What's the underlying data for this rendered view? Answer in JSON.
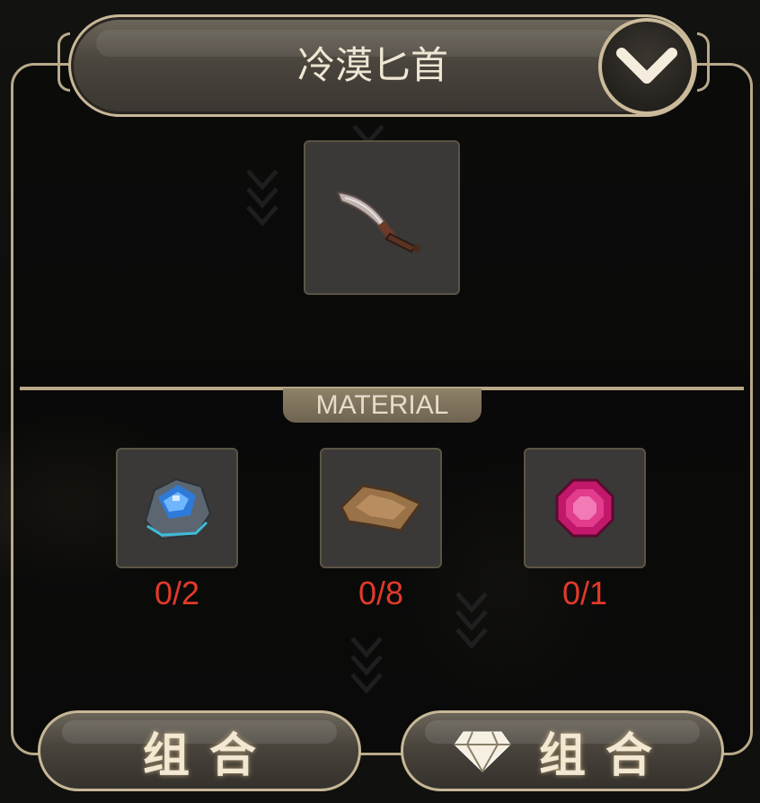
{
  "title": {
    "item_name": "冷漠匕首"
  },
  "crafting": {
    "result_item": {
      "icon": "dagger-icon"
    },
    "section_label": "MATERIAL",
    "materials": [
      {
        "icon": "blue-ore-icon",
        "count": "0/2"
      },
      {
        "icon": "leather-hide-icon",
        "count": "0/8"
      },
      {
        "icon": "pink-gem-icon",
        "count": "0/1"
      }
    ]
  },
  "buttons": {
    "combine_label": "组合",
    "gem_combine_label": "组合",
    "gem_icon": "diamond-icon"
  },
  "colors": {
    "frame_border": "#b9a98b",
    "count_text": "#e23a2a",
    "slot_bg": "#3a3937"
  }
}
